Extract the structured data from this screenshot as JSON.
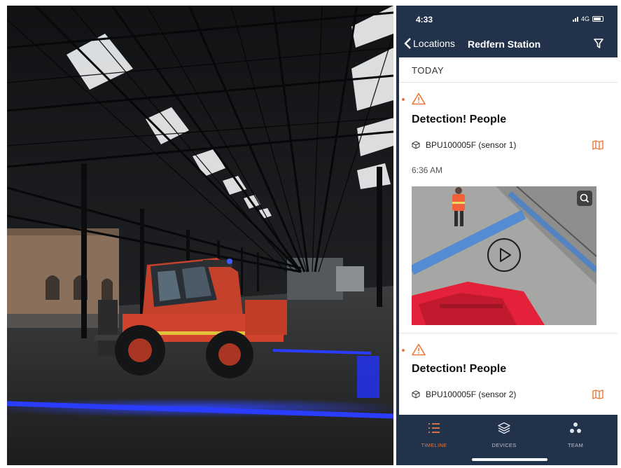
{
  "status_bar": {
    "time": "4:33",
    "network": "4G"
  },
  "nav": {
    "back_label": "Locations",
    "title": "Redfern Station"
  },
  "section": {
    "label": "TODAY"
  },
  "events": [
    {
      "title": "Detection! People",
      "sensor": "BPU100005F (sensor 1)",
      "time": "6:36 AM"
    },
    {
      "title": "Detection! People",
      "sensor": "BPU100005F (sensor 2)"
    }
  ],
  "tabs": [
    {
      "label": "TIMELINE",
      "icon": "list-icon",
      "active": true
    },
    {
      "label": "DEVICES",
      "icon": "layers-icon",
      "active": false
    },
    {
      "label": "TEAM",
      "icon": "team-icon",
      "active": false
    }
  ],
  "colors": {
    "nav_bg": "#22324a",
    "accent": "#e8783a",
    "blue_light": "#2a3cff"
  }
}
